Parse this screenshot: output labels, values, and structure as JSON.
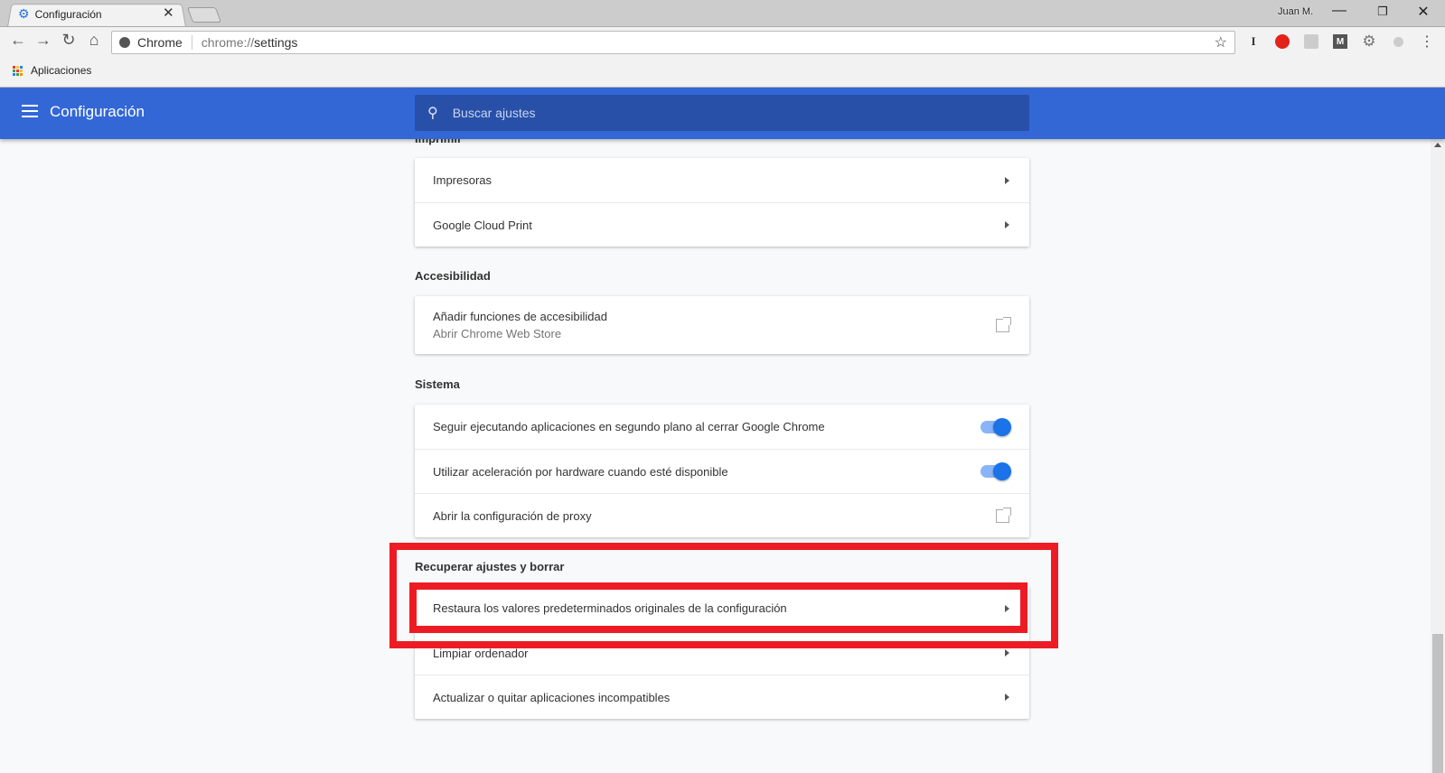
{
  "browser": {
    "tab_title": "Configuración",
    "user": "Juan M.",
    "omnibox": {
      "site": "Chrome",
      "url_prefix": "chrome://",
      "url_path": "settings"
    },
    "bookmarks": [
      {
        "label": "Aplicaciones"
      }
    ],
    "extensions": [
      "instapaper-icon",
      "adblock-icon",
      "rss-icon",
      "mega-icon",
      "gear-extension-icon",
      "extension-icon"
    ]
  },
  "header": {
    "title": "Configuración",
    "search_placeholder": "Buscar ajustes",
    "accent": "#3367d6"
  },
  "sections": {
    "imprimir": {
      "title": "Imprimir",
      "items": [
        "Impresoras",
        "Google Cloud Print"
      ]
    },
    "accesibilidad": {
      "title": "Accesibilidad",
      "item": "Añadir funciones de accesibilidad",
      "item_sub": "Abrir Chrome Web Store"
    },
    "sistema": {
      "title": "Sistema",
      "items": [
        {
          "label": "Seguir ejecutando aplicaciones en segundo plano al cerrar Google Chrome",
          "toggle": true
        },
        {
          "label": "Utilizar aceleración por hardware cuando esté disponible",
          "toggle": true
        },
        {
          "label": "Abrir la configuración de proxy"
        }
      ]
    },
    "recuperar": {
      "title": "Recuperar ajustes y borrar",
      "items": [
        "Restaura los valores predeterminados originales de la configuración",
        "Limpiar ordenador",
        "Actualizar o quitar aplicaciones incompatibles"
      ]
    }
  },
  "annotation_color": "#ed1c24"
}
